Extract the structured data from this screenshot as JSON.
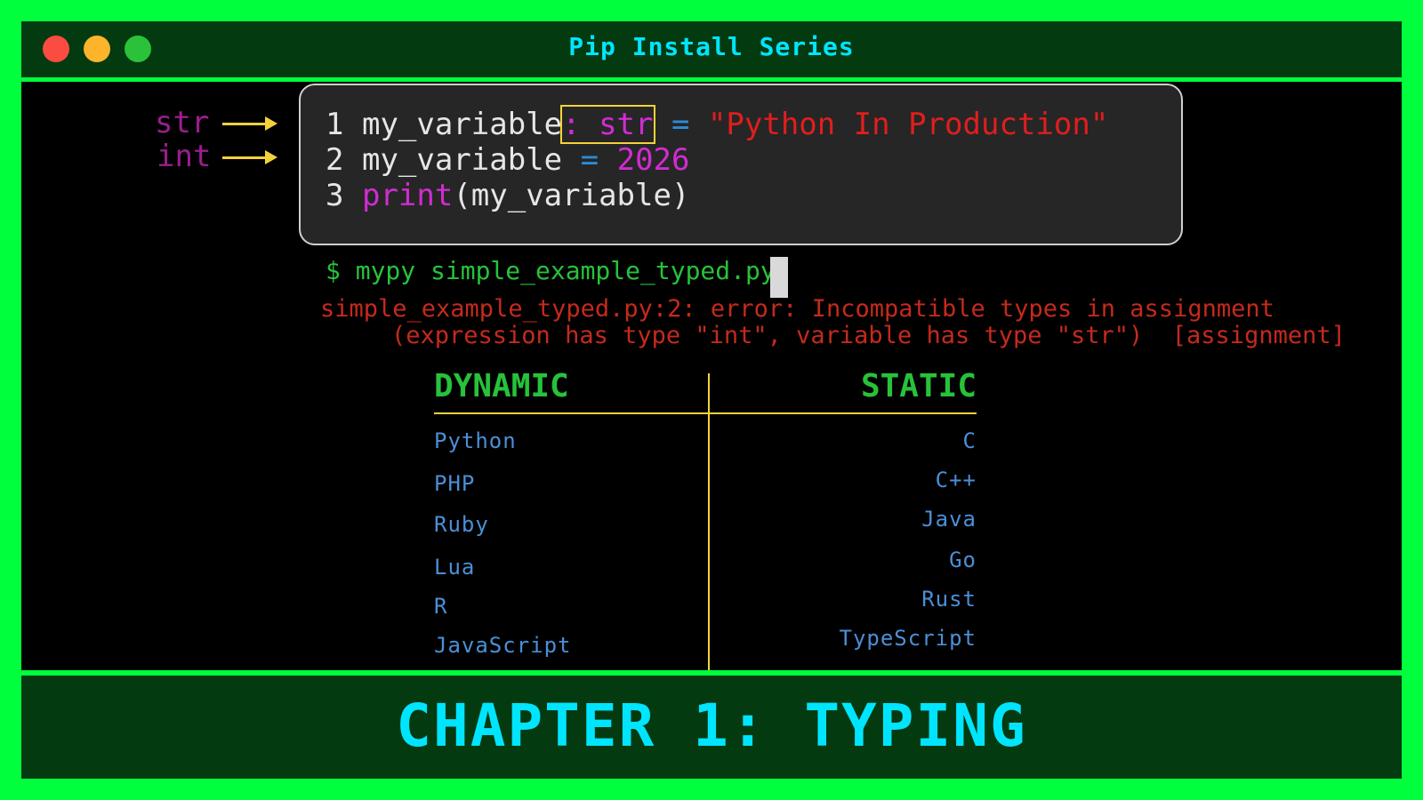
{
  "window": {
    "title": "Pip Install Series"
  },
  "annotations": {
    "str_label": "str",
    "int_label": "int"
  },
  "code": {
    "line1": {
      "num": "1",
      "name": "my_variable",
      "colon_type": ": str",
      "op": "=",
      "value": "\"Python In Production\""
    },
    "line2": {
      "num": "2",
      "name": "my_variable",
      "op": "=",
      "value": "2026"
    },
    "line3": {
      "num": "3",
      "func": "print",
      "args": "(my_variable)"
    }
  },
  "terminal": {
    "command": "$ mypy simple_example_typed.py",
    "error_line1": "simple_example_typed.py:2: error: Incompatible types in assignment",
    "error_line2": "(expression has type \"int\", variable has type \"str\")  [assignment]"
  },
  "table": {
    "left_header": "DYNAMIC",
    "right_header": "STATIC",
    "dynamic": [
      "Python",
      "PHP",
      "Ruby",
      "Lua",
      "R",
      "JavaScript"
    ],
    "static": [
      "C",
      "C++",
      "Java",
      "Go",
      "Rust",
      "TypeScript"
    ]
  },
  "footer": {
    "chapter": "CHAPTER 1: TYPING"
  },
  "colors": {
    "frame": "#00ff3c",
    "bar": "#033a10",
    "title": "#00e5ff",
    "keyword": "#d12cd1",
    "string": "#e01e1e",
    "error": "#c42a1c",
    "header": "#27c23a",
    "lang": "#4a8fd6",
    "accent": "#f5d23a"
  }
}
